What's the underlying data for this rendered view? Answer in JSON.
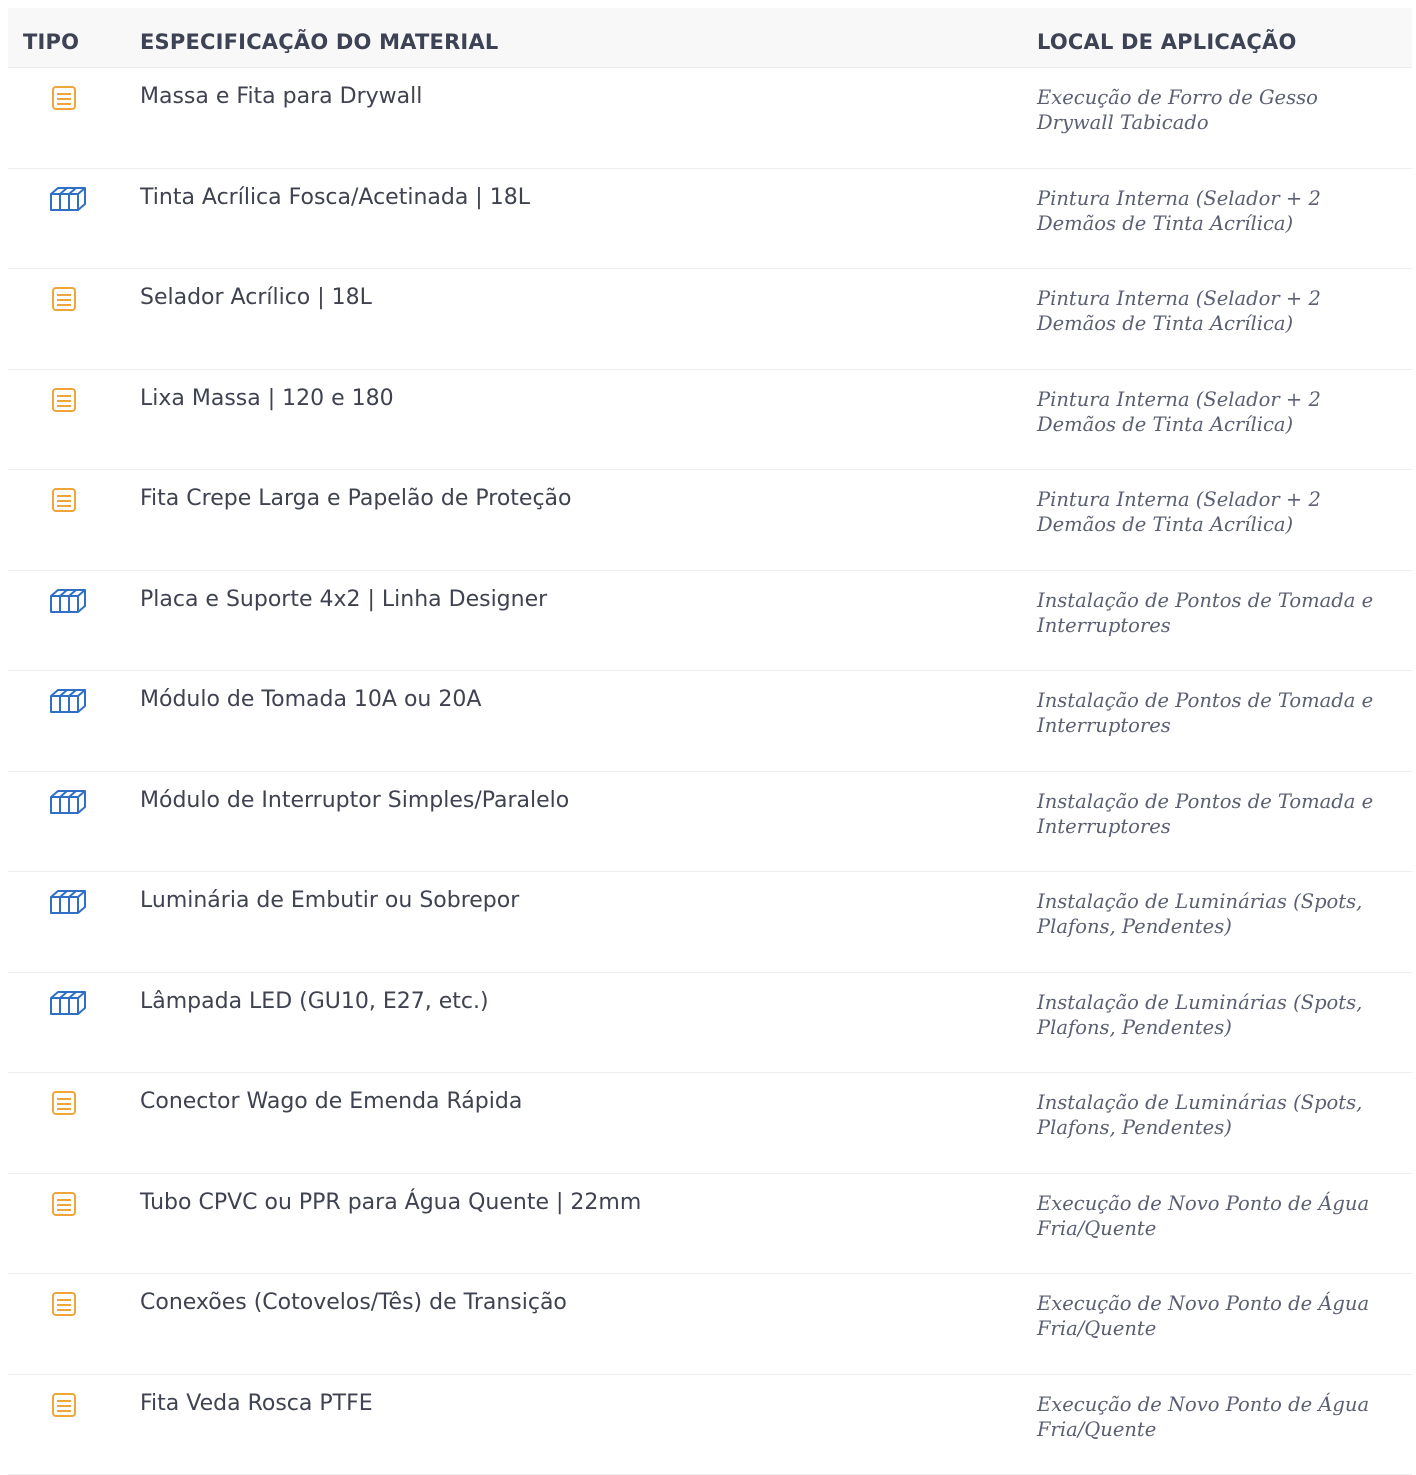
{
  "header": {
    "tipo": "TIPO",
    "especificacao": "ESPECIFICAÇÃO DO MATERIAL",
    "local": "LOCAL DE APLICAÇÃO"
  },
  "colors": {
    "doc_icon": "#f0a53a",
    "box_icon": "#2f6fc6"
  },
  "rows": [
    {
      "type_icon": "document-icon",
      "spec": "Massa e Fita para Drywall",
      "local": "Execução de Forro de Gesso Drywall Tabicado"
    },
    {
      "type_icon": "box-icon",
      "spec": "Tinta Acrílica Fosca/Acetinada | 18L",
      "local": "Pintura Interna (Selador + 2 Demãos de Tinta Acrílica)"
    },
    {
      "type_icon": "document-icon",
      "spec": "Selador Acrílico | 18L",
      "local": "Pintura Interna (Selador + 2 Demãos de Tinta Acrílica)"
    },
    {
      "type_icon": "document-icon",
      "spec": "Lixa Massa | 120 e 180",
      "local": "Pintura Interna (Selador + 2 Demãos de Tinta Acrílica)"
    },
    {
      "type_icon": "document-icon",
      "spec": "Fita Crepe Larga e Papelão de Proteção",
      "local": "Pintura Interna (Selador + 2 Demãos de Tinta Acrílica)"
    },
    {
      "type_icon": "box-icon",
      "spec": "Placa e Suporte 4x2 | Linha Designer",
      "local": "Instalação de Pontos de Tomada e Interruptores"
    },
    {
      "type_icon": "box-icon",
      "spec": "Módulo de Tomada 10A ou 20A",
      "local": "Instalação de Pontos de Tomada e Interruptores"
    },
    {
      "type_icon": "box-icon",
      "spec": "Módulo de Interruptor Simples/Paralelo",
      "local": "Instalação de Pontos de Tomada e Interruptores"
    },
    {
      "type_icon": "box-icon",
      "spec": "Luminária de Embutir ou Sobrepor",
      "local": "Instalação de Luminárias (Spots, Plafons, Pendentes)"
    },
    {
      "type_icon": "box-icon",
      "spec": "Lâmpada LED (GU10, E27, etc.)",
      "local": "Instalação de Luminárias (Spots, Plafons, Pendentes)"
    },
    {
      "type_icon": "document-icon",
      "spec": "Conector Wago de Emenda Rápida",
      "local": "Instalação de Luminárias (Spots, Plafons, Pendentes)"
    },
    {
      "type_icon": "document-icon",
      "spec": "Tubo CPVC ou PPR para Água Quente | 22mm",
      "local": "Execução de Novo Ponto de Água Fria/Quente"
    },
    {
      "type_icon": "document-icon",
      "spec": "Conexões (Cotovelos/Tês) de Transição",
      "local": "Execução de Novo Ponto de Água Fria/Quente"
    },
    {
      "type_icon": "document-icon",
      "spec": "Fita Veda Rosca PTFE",
      "local": "Execução de Novo Ponto de Água Fria/Quente"
    }
  ]
}
